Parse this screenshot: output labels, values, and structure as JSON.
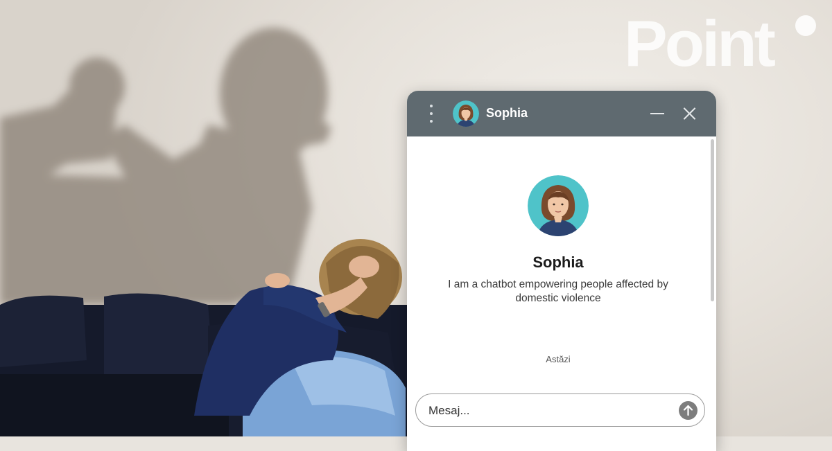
{
  "brand": {
    "logo_text": "Point",
    "logo_color": "#ffffff"
  },
  "chat": {
    "header": {
      "bot_name": "Sophia",
      "menu_icon": "vertical-dots-icon",
      "minimize_icon": "minimize-icon",
      "close_icon": "close-icon",
      "background_color": "#5f6a70"
    },
    "profile": {
      "name": "Sophia",
      "description": "I am a chatbot empowering people affected by domestic violence",
      "avatar_bg_color": "#4fc3c9"
    },
    "date_separator": "Astăzi",
    "composer": {
      "placeholder": "Mesaj...",
      "send_icon": "arrow-up-icon"
    }
  },
  "background": {
    "scene": "photo-background",
    "accent_colors": [
      "#e8e4de",
      "#1f2f63",
      "#8fb3d9"
    ]
  }
}
